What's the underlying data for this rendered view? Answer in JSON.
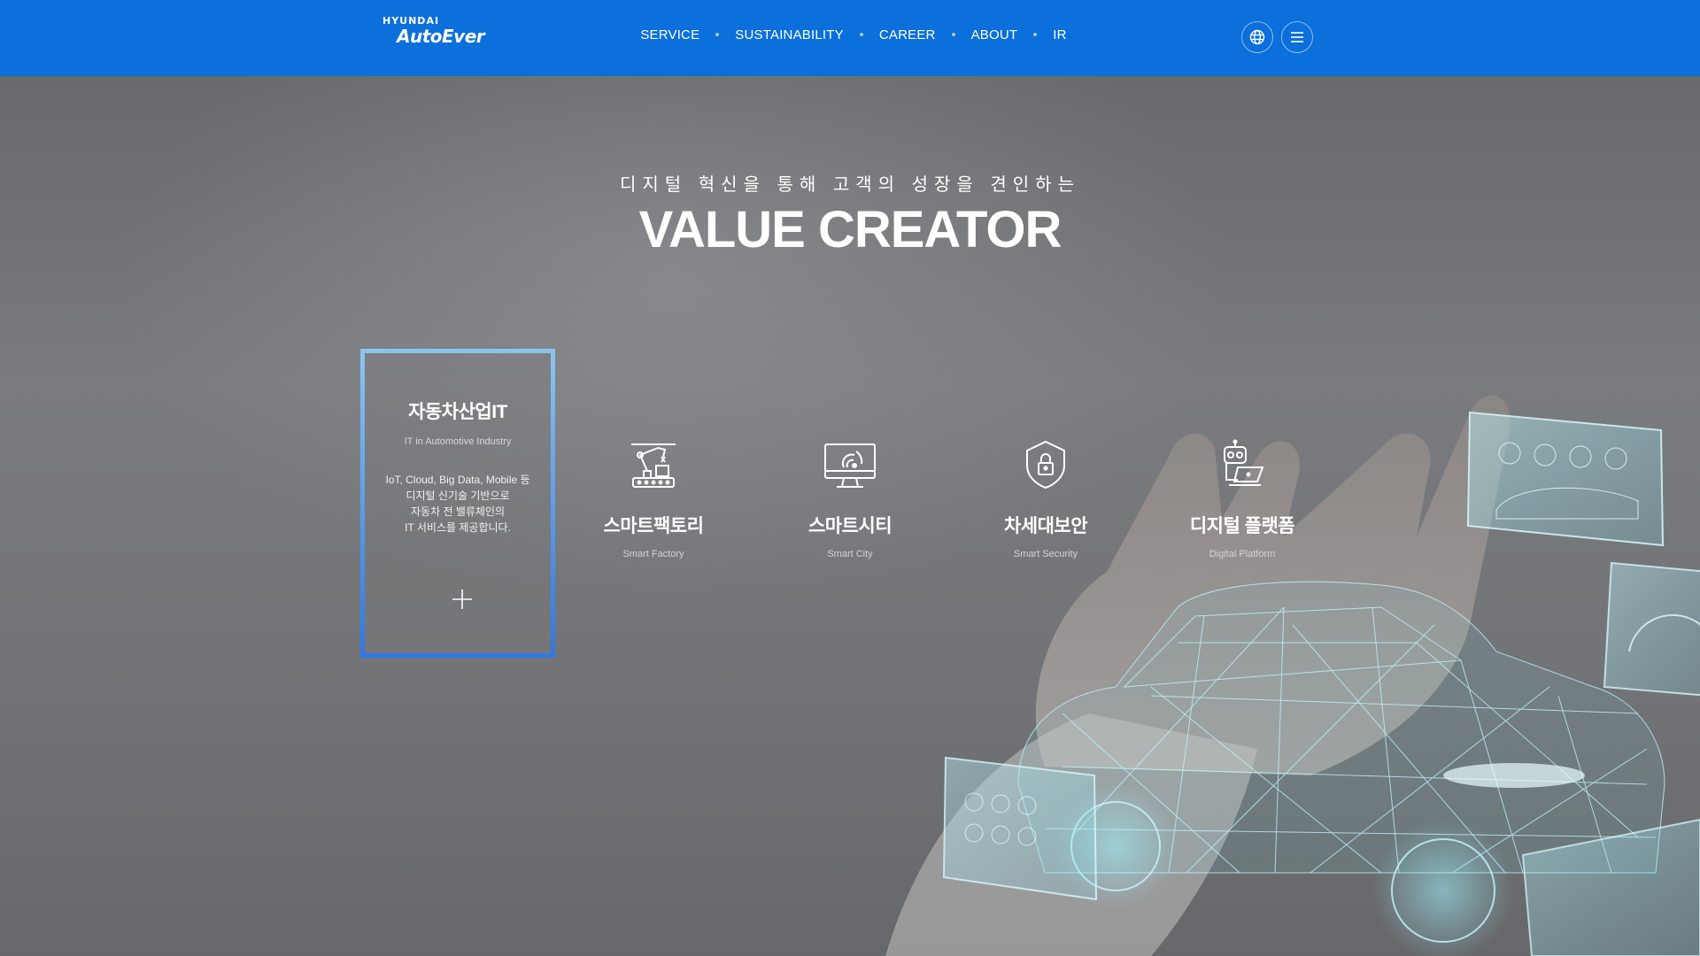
{
  "brand": {
    "top": "HYUNDAI",
    "bottom": "AutoEver"
  },
  "nav": {
    "items": [
      {
        "label": "SERVICE"
      },
      {
        "label": "SUSTAINABILITY"
      },
      {
        "label": "CAREER"
      },
      {
        "label": "ABOUT"
      },
      {
        "label": "IR"
      }
    ]
  },
  "header_actions": {
    "language_icon": "globe-icon",
    "menu_icon": "hamburger-icon"
  },
  "hero": {
    "tagline": "디지털 혁신을 통해 고객의 성장을 견인하는",
    "headline": "VALUE CREATOR"
  },
  "active_card": {
    "title": "자동차산업IT",
    "subtitle": "IT in Automotive Industry",
    "description": "IoT, Cloud, Big Data, Mobile 등\n디지털 신기술 기반으로\n자동차 전 밸류체인의\nIT 서비스를 제공합니다.",
    "action_icon": "plus-icon"
  },
  "services": [
    {
      "title": "스마트팩토리",
      "subtitle": "Smart Factory",
      "icon": "robot-arm-icon"
    },
    {
      "title": "스마트시티",
      "subtitle": "Smart City",
      "icon": "monitor-signal-icon"
    },
    {
      "title": "차세대보안",
      "subtitle": "Smart Security",
      "icon": "shield-lock-icon"
    },
    {
      "title": "디지털 플랫폼",
      "subtitle": "Digital Platform",
      "icon": "robot-laptop-icon"
    }
  ],
  "colors": {
    "header": "#0b6fdc",
    "card_border": "#3b8ef0",
    "hologram": "#7fe6f2"
  }
}
